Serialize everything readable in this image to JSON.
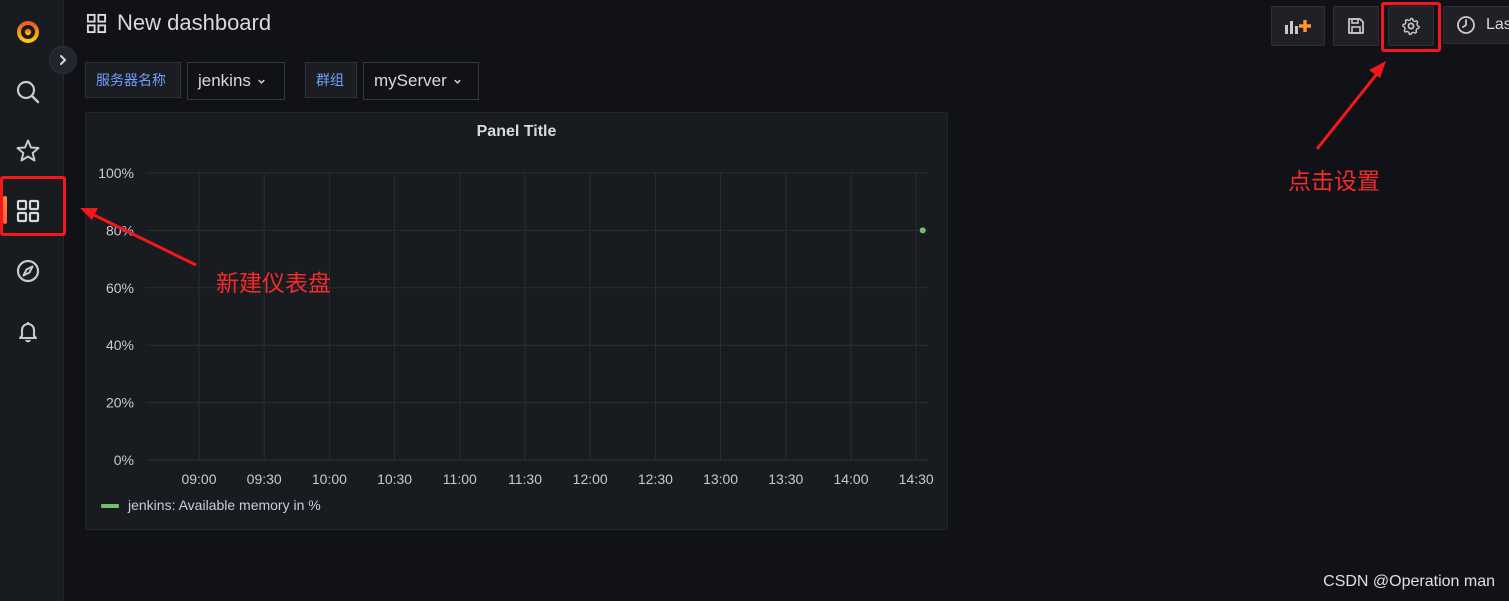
{
  "sidebar": {
    "items": [
      {
        "name": "grafana-logo-icon"
      },
      {
        "name": "search-icon"
      },
      {
        "name": "star-icon"
      },
      {
        "name": "dashboards-icon"
      },
      {
        "name": "explore-icon"
      },
      {
        "name": "alerting-bell-icon"
      }
    ]
  },
  "header": {
    "title": "New dashboard",
    "time_picker_label": "Las"
  },
  "variables": [
    {
      "label": "服务器名称",
      "value": "jenkins"
    },
    {
      "label": "群组",
      "value": "myServer"
    }
  ],
  "panel": {
    "title": "Panel Title"
  },
  "chart_data": {
    "type": "line",
    "title": "Panel Title",
    "x": [
      "09:00",
      "09:30",
      "10:00",
      "10:30",
      "11:00",
      "11:30",
      "12:00",
      "12:30",
      "13:00",
      "13:30",
      "14:00",
      "14:30"
    ],
    "y_ticks": [
      "0%",
      "20%",
      "40%",
      "60%",
      "80%",
      "100%"
    ],
    "ylim": [
      0,
      100
    ],
    "series": [
      {
        "name": "jenkins: Available memory in %",
        "color": "#73bf69",
        "points": [
          {
            "x": "14:33",
            "y": 80
          }
        ]
      }
    ],
    "grid": true,
    "legend": "bottom-left"
  },
  "annotations": {
    "settings_hint": "点击设置",
    "dashboard_hint": "新建仪表盘"
  },
  "watermark": "CSDN @Operation man",
  "colors": {
    "accent": "#f4171b",
    "series": "#73bf69",
    "link": "#6e9fff"
  }
}
